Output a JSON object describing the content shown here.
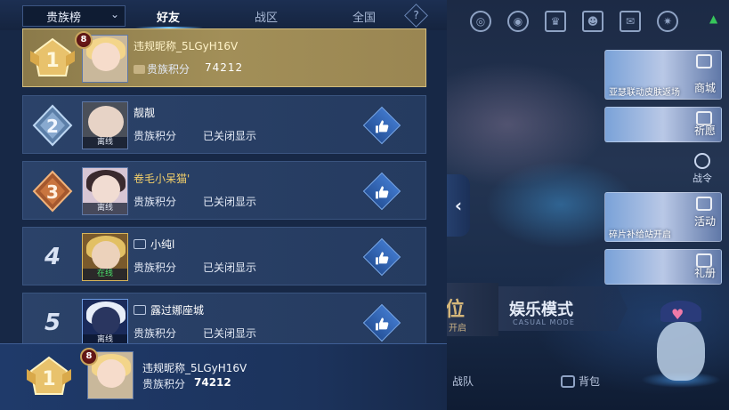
{
  "header": {
    "dropdown_label": "贵族榜",
    "tabs": [
      "好友",
      "战区",
      "全国"
    ],
    "help_label": "?"
  },
  "rows": [
    {
      "rank": "1",
      "level": "8",
      "name": "违规昵称_5LGyH16V",
      "score_label": "贵族积分",
      "score": "74212",
      "status": ""
    },
    {
      "rank": "2",
      "name": "靓靓",
      "score_label": "贵族积分",
      "score": "已关闭显示",
      "status": "离线"
    },
    {
      "rank": "3",
      "name": "卷毛小呆猫'",
      "score_label": "贵族积分",
      "score": "已关闭显示",
      "status": "离线"
    },
    {
      "rank": "4",
      "name": "小纯l",
      "score_label": "贵族积分",
      "score": "已关闭显示",
      "status": "在线"
    },
    {
      "rank": "5",
      "name": "露过娜座城",
      "score_label": "贵族积分",
      "score": "已关闭显示",
      "status": "离线"
    }
  ],
  "pinned": {
    "rank": "1",
    "level": "8",
    "name": "违规昵称_5LGyH16V",
    "score_label": "贵族积分",
    "score": "74212"
  },
  "side_menu": {
    "shop": "商城",
    "shop_caption": "亚瑟联动皮肤返场",
    "wish": "祈愿",
    "battle_pass": "战令",
    "activity": "活动",
    "activity_caption": "碎片补给站开启",
    "album": "礼册"
  },
  "mode": {
    "rank_partial": "位",
    "open_partial": "开启",
    "entertainment": "娱乐模式",
    "entertainment_en": "CASUAL MODE"
  },
  "bottom_nav": {
    "team": "战队",
    "bag": "背包"
  },
  "icons": {
    "expand": "chevron-left-icon",
    "like": "thumbs-up-icon"
  },
  "colors": {
    "panel_bg": "#172846",
    "row_bg": "#2b4269",
    "self_row_bg": "#a28f58",
    "gold": "#d9b25c",
    "online": "#49e26b"
  }
}
